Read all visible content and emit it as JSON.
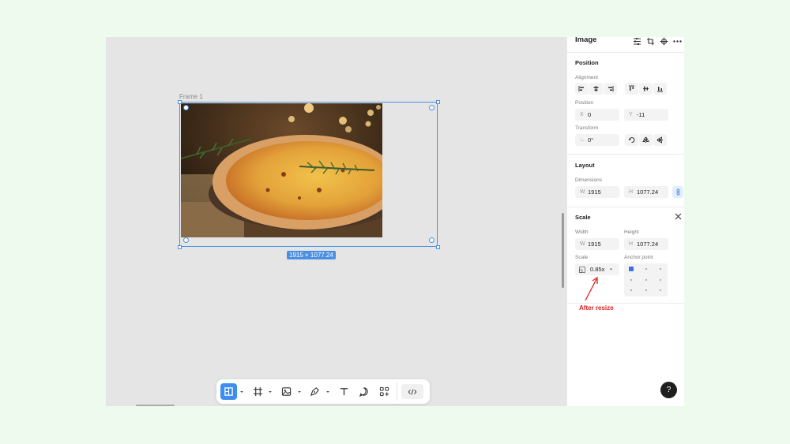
{
  "canvas": {
    "frame_label": "Frame 1",
    "size_badge": "1915 × 1077.24"
  },
  "toolbar": {
    "tools": [
      {
        "icon": "select-frame-icon",
        "active": true
      },
      {
        "icon": "frame-hash-icon"
      },
      {
        "icon": "image-icon"
      },
      {
        "icon": "pen-icon"
      },
      {
        "icon": "text-icon"
      },
      {
        "icon": "comment-icon"
      },
      {
        "icon": "components-icon"
      },
      {
        "icon": "code-icon"
      }
    ]
  },
  "panel": {
    "title": "Image",
    "position_section": {
      "title": "Position",
      "alignment_label": "Alignment",
      "position_label": "Position",
      "x_prefix": "X",
      "x_value": "0",
      "y_prefix": "Y",
      "y_value": "-11",
      "transform_label": "Transform",
      "rotation_value": "0°"
    },
    "layout_section": {
      "title": "Layout",
      "dimensions_label": "Dimensions",
      "w_prefix": "W",
      "w_value": "1915",
      "h_prefix": "H",
      "h_value": "1077.24"
    },
    "scale_section": {
      "title": "Scale",
      "width_label": "Width",
      "height_label": "Height",
      "w_prefix": "W",
      "w_value": "1915",
      "h_prefix": "H",
      "h_value": "1077.24",
      "scale_label": "Scale",
      "scale_value": "0.85x",
      "anchor_label": "Anchor point"
    },
    "annotation": "After resize",
    "help_label": "?"
  },
  "colors": {
    "accent": "#4a90e2",
    "annotation": "#e02020",
    "page_background": "#eefaee"
  }
}
